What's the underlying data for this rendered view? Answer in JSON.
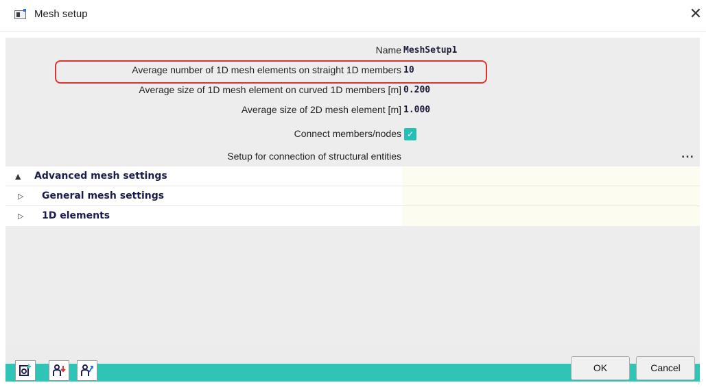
{
  "window": {
    "title": "Mesh setup",
    "close_symbol": "✕"
  },
  "properties": [
    {
      "label": "Name",
      "value": "MeshSetup1"
    },
    {
      "label": "Average number of 1D mesh elements on straight 1D members",
      "value": "10"
    },
    {
      "label": "Average size of 1D mesh element on curved 1D members [m]",
      "value": "0.200"
    },
    {
      "label": "Average size of 2D mesh element [m]",
      "value": "1.000"
    },
    {
      "label": "Connect members/nodes",
      "checked": true
    },
    {
      "label": "Setup for connection of structural entities",
      "action": "..."
    }
  ],
  "sections": [
    {
      "title": "Advanced mesh settings",
      "expanded": true
    },
    {
      "title": "General mesh settings",
      "expanded": false
    },
    {
      "title": "1D elements",
      "expanded": false
    }
  ],
  "toolbar": {
    "icons": [
      "new-document-icon",
      "import-user-icon",
      "export-user-icon"
    ]
  },
  "buttons": {
    "ok": "OK",
    "cancel": "Cancel"
  },
  "colors": {
    "accent": "#2ec4b6",
    "highlight": "#e0322f",
    "checkbox": "#26bfb3"
  }
}
